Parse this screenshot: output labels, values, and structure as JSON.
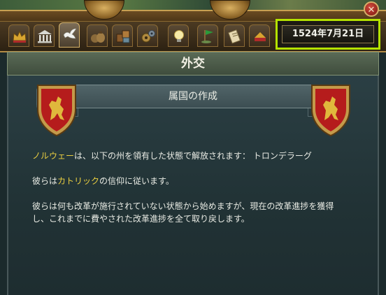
{
  "window": {
    "close_glyph": "✕",
    "date": "1524年7月21日",
    "title": "外交"
  },
  "tabs": [
    {
      "icon": "crown-icon"
    },
    {
      "icon": "government-building-icon"
    },
    {
      "icon": "dove-icon",
      "active": true
    },
    {
      "icon": "economy-sacks-icon"
    },
    {
      "icon": "trade-crates-icon"
    },
    {
      "icon": "technology-gears-icon"
    },
    {
      "icon": "ideas-lightbulb-icon"
    },
    {
      "icon": "missions-flag-icon"
    },
    {
      "icon": "decisions-scroll-icon"
    },
    {
      "icon": "military-icon"
    }
  ],
  "subheader": {
    "title": "属国の作成"
  },
  "release": {
    "country": "ノルウェー",
    "line1_rest": "は、以下の州を領有した状態で解放されます： トロンデラーグ",
    "religion_prefix": "彼らは",
    "religion": "カトリック",
    "religion_suffix": "の信仰に従います。",
    "reform_line1": "彼らは何も改革が施行されていない状態から始めますが、現在の改革進捗を獲得",
    "reform_line2": "し、これまでに費やされた改革進捗を全て取り戻します。"
  },
  "colors": {
    "highlight": "#ecd040",
    "date_outline": "#b4e200",
    "shield_red": "#b51c1c",
    "lion_gold": "#e0b83c"
  }
}
